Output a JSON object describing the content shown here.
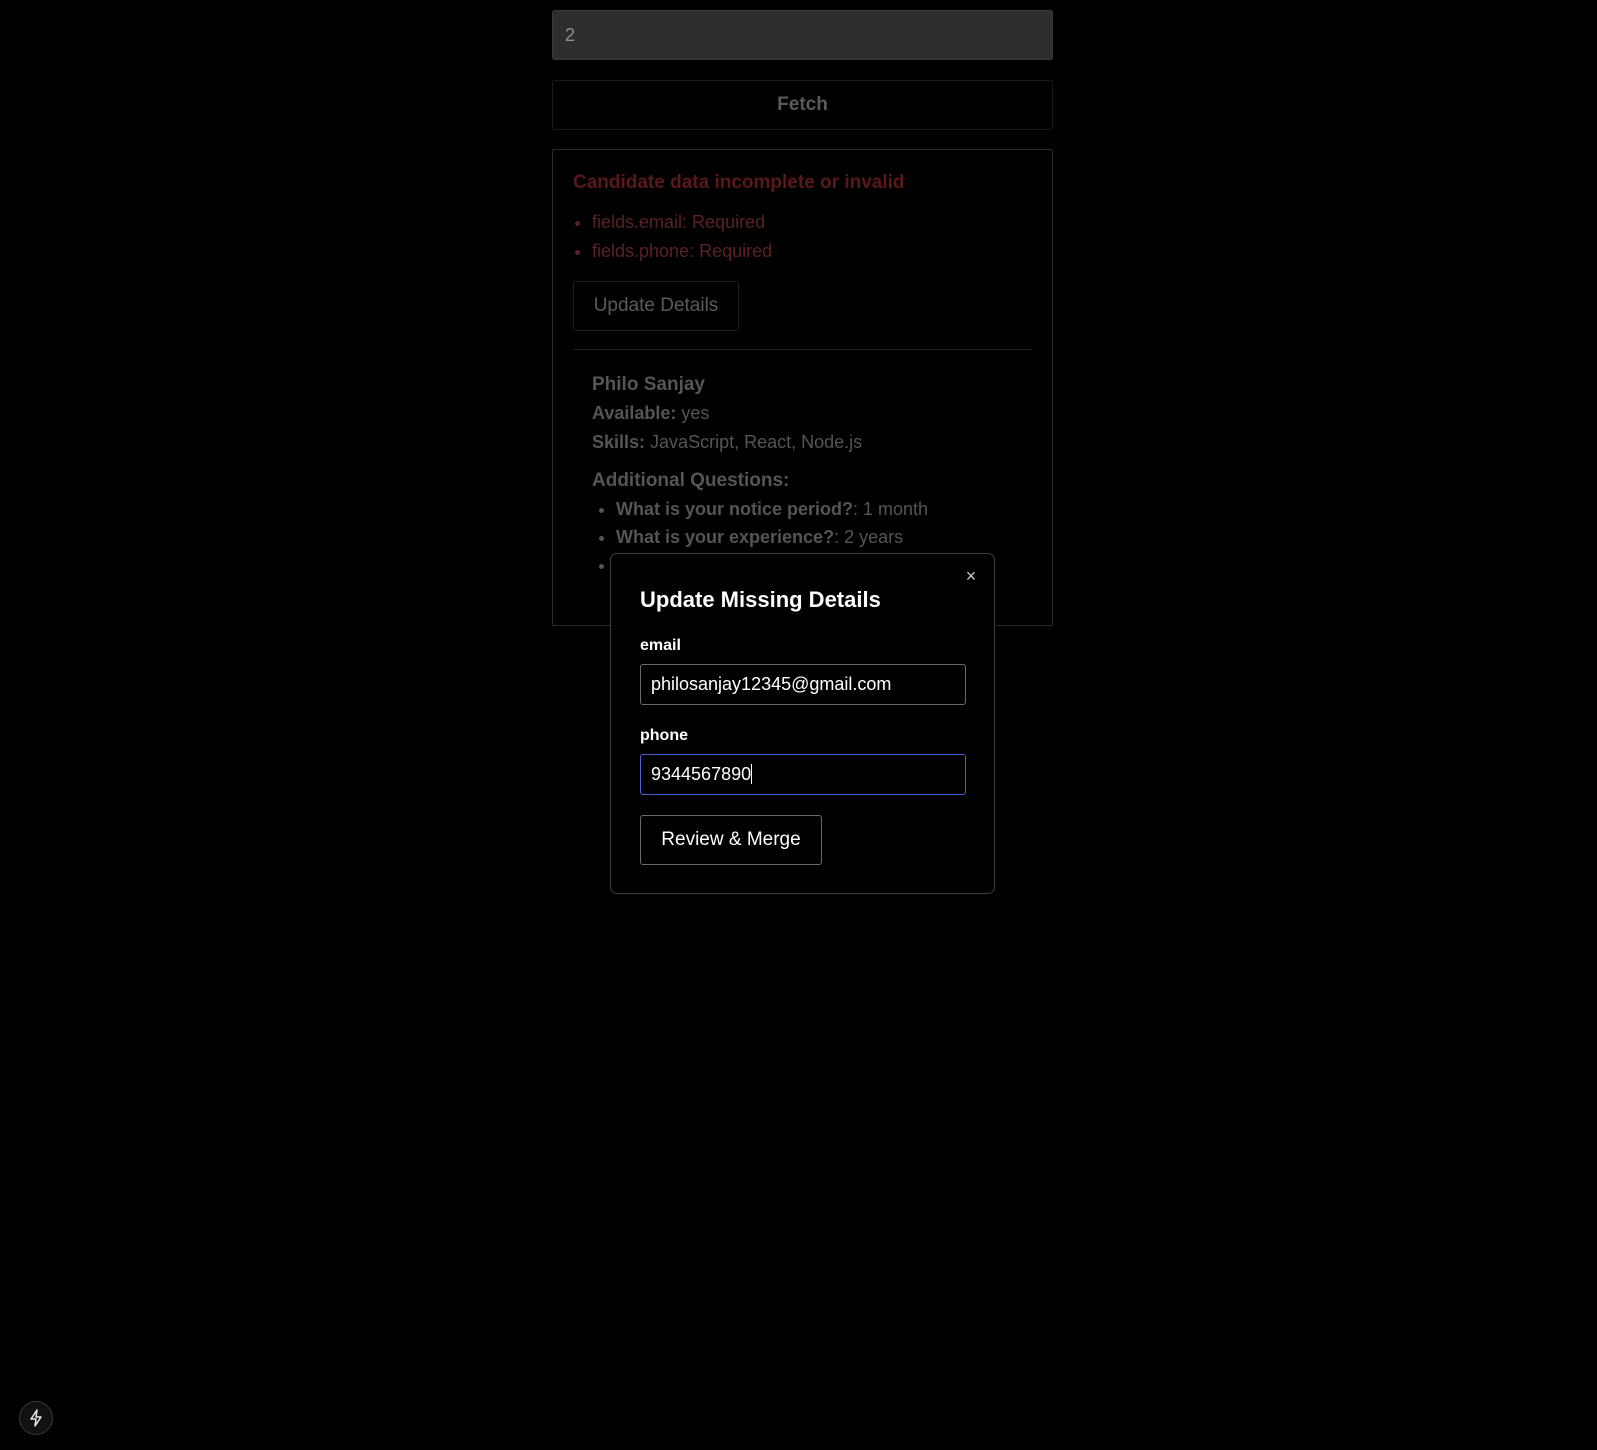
{
  "search": {
    "value": "2",
    "fetch_label": "Fetch"
  },
  "error": {
    "title": "Candidate data incomplete or invalid",
    "items": [
      "fields.email: Required",
      "fields.phone: Required"
    ],
    "update_label": "Update Details"
  },
  "candidate": {
    "name": "Philo Sanjay",
    "available_label": "Available:",
    "available_value": "yes",
    "skills_label": "Skills:",
    "skills_value": "JavaScript, React, Node.js",
    "additional_title": "Additional Questions:",
    "questions": [
      {
        "q": "What is your notice period?",
        "a": ": 1 month"
      },
      {
        "q": "What is your experience?",
        "a": ": 2 years"
      }
    ]
  },
  "modal": {
    "title": "Update Missing Details",
    "close_glyph": "×",
    "email_label": "email",
    "email_value": "philosanjay12345@gmail.com",
    "phone_label": "phone",
    "phone_value": "9344567890",
    "merge_label": "Review & Merge"
  },
  "colors": {
    "background": "#000000",
    "focus_border": "#4a5fd6",
    "error_text": "#5b1818"
  },
  "icons": {
    "close": "close-icon",
    "dev_tools": "lightning-bolt-icon"
  }
}
